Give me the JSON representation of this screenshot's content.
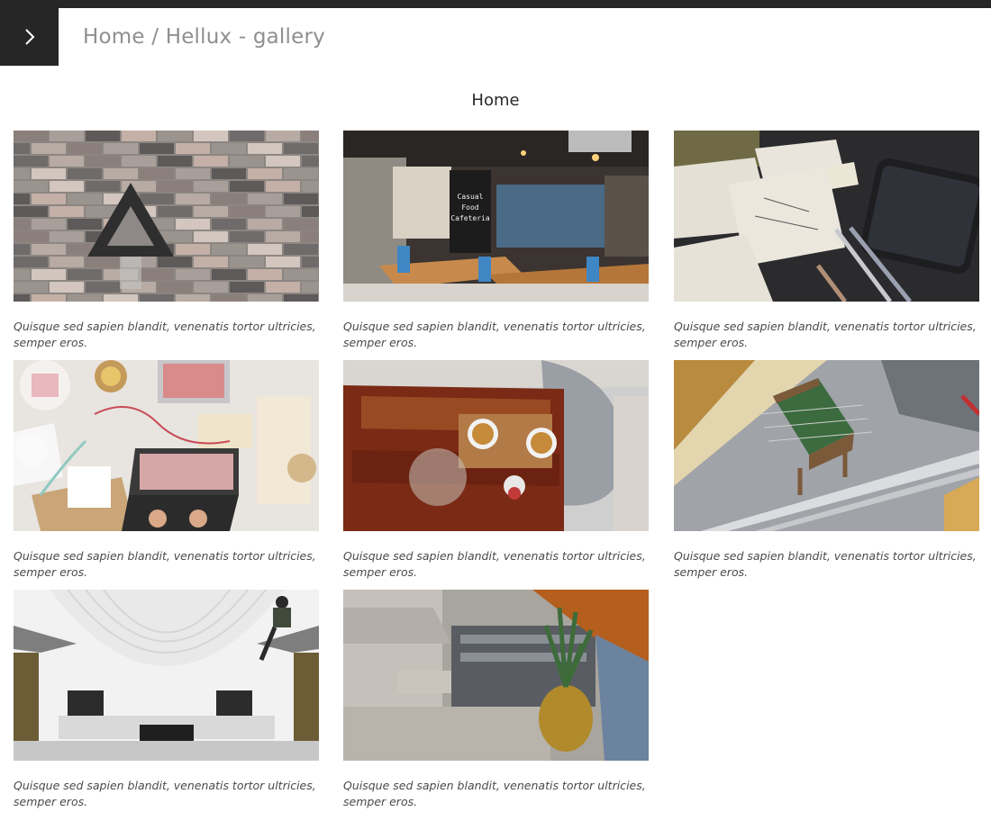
{
  "header": {
    "menu_icon": "chevron-right-icon",
    "breadcrumb": "Home / Hellux - gallery"
  },
  "page": {
    "title": "Home"
  },
  "gallery": {
    "items": [
      {
        "caption": "Quisque sed sapien blandit, venenatis tortor ultricies, semper eros."
      },
      {
        "caption": "Quisque sed sapien blandit, venenatis tortor ultricies, semper eros.",
        "sign_text": [
          "Casual",
          "Food",
          "Cafeteria"
        ]
      },
      {
        "caption": "Quisque sed sapien blandit, venenatis tortor ultricies, semper eros."
      },
      {
        "caption": "Quisque sed sapien blandit, venenatis tortor ultricies, semper eros."
      },
      {
        "caption": "Quisque sed sapien blandit, venenatis tortor ultricies, semper eros."
      },
      {
        "caption": "Quisque sed sapien blandit, venenatis tortor ultricies, semper eros."
      },
      {
        "caption": "Quisque sed sapien blandit, venenatis tortor ultricies, semper eros."
      },
      {
        "caption": "Quisque sed sapien blandit, venenatis tortor ultricies, semper eros."
      }
    ]
  },
  "colors": {
    "header_dark": "#262626",
    "breadcrumb_text": "#8f8f8f",
    "caption_text": "#4a4a4a"
  }
}
